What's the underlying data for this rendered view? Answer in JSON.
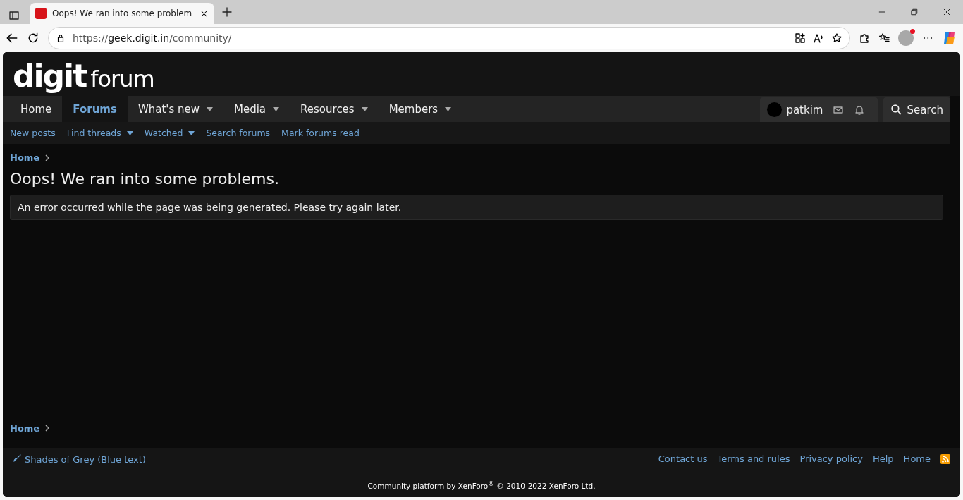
{
  "browser": {
    "tab_title": "Oops! We ran into some problem",
    "url_host": "geek.digit.in",
    "url_scheme": "https://",
    "url_path": "/community/"
  },
  "logo": {
    "brand": "digit",
    "suffix": "forum"
  },
  "nav": [
    {
      "label": "Home",
      "selected": false,
      "menu": false
    },
    {
      "label": "Forums",
      "selected": true,
      "menu": false
    },
    {
      "label": "What's new",
      "selected": false,
      "menu": true
    },
    {
      "label": "Media",
      "selected": false,
      "menu": true
    },
    {
      "label": "Resources",
      "selected": false,
      "menu": true
    },
    {
      "label": "Members",
      "selected": false,
      "menu": true
    }
  ],
  "user": {
    "name": "patkim"
  },
  "search": {
    "label": "Search"
  },
  "subnav": [
    {
      "label": "New posts",
      "menu": false
    },
    {
      "label": "Find threads",
      "menu": true
    },
    {
      "label": "Watched",
      "menu": true
    },
    {
      "label": "Search forums",
      "menu": false
    },
    {
      "label": "Mark forums read",
      "menu": false
    }
  ],
  "breadcrumb_top": "Home",
  "title": "Oops! We ran into some problems.",
  "error_message": "An error occurred while the page was being generated. Please try again later.",
  "breadcrumb_bottom": "Home",
  "footer": {
    "style_chooser": "Shades of Grey (Blue text)",
    "links": [
      "Contact us",
      "Terms and rules",
      "Privacy policy",
      "Help",
      "Home"
    ],
    "copyright": "Community platform by XenForo$^{®}$ © 2010-2022 XenForo Ltd."
  }
}
